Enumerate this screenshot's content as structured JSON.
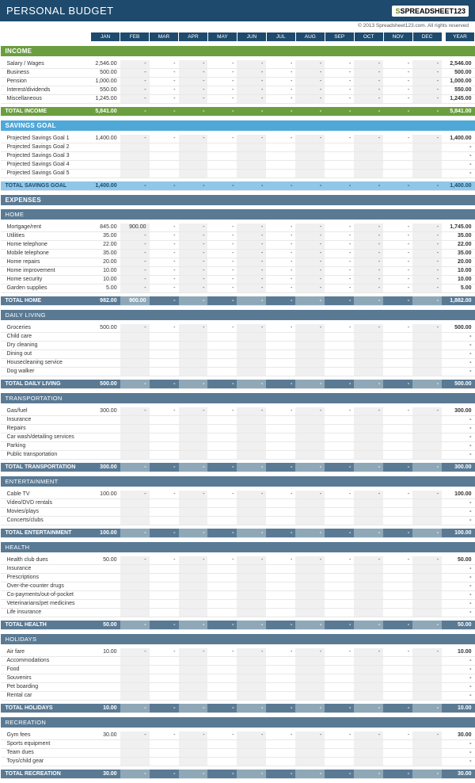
{
  "title": "PERSONAL BUDGET",
  "logo_text": "SPREADSHEET123",
  "copyright": "© 2013 Spreadsheet123.com. All rights reserved",
  "months": [
    "JAN",
    "FEB",
    "MAR",
    "APR",
    "MAY",
    "JUN",
    "JUL",
    "AUG",
    "SEP",
    "OCT",
    "NOV",
    "DEC",
    "YEAR"
  ],
  "sections": [
    {
      "type": "top",
      "title": "INCOME",
      "class": "income",
      "rows": [
        {
          "label": "Salary / Wages",
          "v": [
            "2,546.00",
            "-",
            "-",
            "-",
            "-",
            "-",
            "-",
            "-",
            "-",
            "-",
            "-",
            "-"
          ],
          "y": "2,546.00"
        },
        {
          "label": "Business",
          "v": [
            "500.00",
            "-",
            "-",
            "-",
            "-",
            "-",
            "-",
            "-",
            "-",
            "-",
            "-",
            "-"
          ],
          "y": "500.00"
        },
        {
          "label": "Pension",
          "v": [
            "1,000.00",
            "-",
            "-",
            "-",
            "-",
            "-",
            "-",
            "-",
            "-",
            "-",
            "-",
            "-"
          ],
          "y": "1,000.00"
        },
        {
          "label": "Interest/dividends",
          "v": [
            "550.00",
            "-",
            "-",
            "-",
            "-",
            "-",
            "-",
            "-",
            "-",
            "-",
            "-",
            "-"
          ],
          "y": "550.00"
        },
        {
          "label": "Miscellaneous",
          "v": [
            "1,245.00",
            "-",
            "-",
            "-",
            "-",
            "-",
            "-",
            "-",
            "-",
            "-",
            "-",
            "-"
          ],
          "y": "1,245.00"
        }
      ],
      "total": {
        "label": "TOTAL INCOME",
        "v": [
          "5,841.00",
          "-",
          "-",
          "-",
          "-",
          "-",
          "-",
          "-",
          "-",
          "-",
          "-",
          "-"
        ],
        "y": "5,841.00",
        "class": "total-income"
      }
    },
    {
      "type": "top",
      "title": "SAVINGS GOAL",
      "class": "savings",
      "rows": [
        {
          "label": "Projected Savings Goal 1",
          "v": [
            "1,400.00",
            "-",
            "-",
            "-",
            "-",
            "-",
            "-",
            "-",
            "-",
            "-",
            "-",
            "-"
          ],
          "y": "1,400.00"
        },
        {
          "label": "Projected Savings Goal 2",
          "v": [
            "",
            "",
            "",
            "",
            "",
            "",
            "",
            "",
            "",
            "",
            "",
            ""
          ],
          "y": "-"
        },
        {
          "label": "Projected Savings Goal 3",
          "v": [
            "",
            "",
            "",
            "",
            "",
            "",
            "",
            "",
            "",
            "",
            "",
            ""
          ],
          "y": "-"
        },
        {
          "label": "Projected Savings Goal 4",
          "v": [
            "",
            "",
            "",
            "",
            "",
            "",
            "",
            "",
            "",
            "",
            "",
            ""
          ],
          "y": "-"
        },
        {
          "label": "Projected Savings Goal 5",
          "v": [
            "",
            "",
            "",
            "",
            "",
            "",
            "",
            "",
            "",
            "",
            "",
            ""
          ],
          "y": "-"
        }
      ],
      "total": {
        "label": "TOTAL SAVINGS GOAL",
        "v": [
          "1,400.00",
          "-",
          "-",
          "-",
          "-",
          "-",
          "-",
          "-",
          "-",
          "-",
          "-",
          "-"
        ],
        "y": "1,400.00",
        "class": "total-savings"
      }
    }
  ],
  "expenses_title": "EXPENSES",
  "subsections": [
    {
      "title": "HOME",
      "rows": [
        {
          "label": "Mortgage/rent",
          "v": [
            "845.00",
            "900.00",
            "-",
            "-",
            "-",
            "-",
            "-",
            "-",
            "-",
            "-",
            "-",
            "-"
          ],
          "y": "1,745.00"
        },
        {
          "label": "Utilities",
          "v": [
            "35.00",
            "-",
            "-",
            "-",
            "-",
            "-",
            "-",
            "-",
            "-",
            "-",
            "-",
            "-"
          ],
          "y": "35.00"
        },
        {
          "label": "Home telephone",
          "v": [
            "22.00",
            "-",
            "-",
            "-",
            "-",
            "-",
            "-",
            "-",
            "-",
            "-",
            "-",
            "-"
          ],
          "y": "22.00"
        },
        {
          "label": "Mobile telephone",
          "v": [
            "35.00",
            "-",
            "-",
            "-",
            "-",
            "-",
            "-",
            "-",
            "-",
            "-",
            "-",
            "-"
          ],
          "y": "35.00"
        },
        {
          "label": "Home repairs",
          "v": [
            "20.00",
            "-",
            "-",
            "-",
            "-",
            "-",
            "-",
            "-",
            "-",
            "-",
            "-",
            "-"
          ],
          "y": "20.00"
        },
        {
          "label": "Home improvement",
          "v": [
            "10.00",
            "-",
            "-",
            "-",
            "-",
            "-",
            "-",
            "-",
            "-",
            "-",
            "-",
            "-"
          ],
          "y": "10.00"
        },
        {
          "label": "Home security",
          "v": [
            "10.00",
            "-",
            "-",
            "-",
            "-",
            "-",
            "-",
            "-",
            "-",
            "-",
            "-",
            "-"
          ],
          "y": "10.00"
        },
        {
          "label": "Garden supplies",
          "v": [
            "5.00",
            "-",
            "-",
            "-",
            "-",
            "-",
            "-",
            "-",
            "-",
            "-",
            "-",
            "-"
          ],
          "y": "5.00"
        }
      ],
      "total": {
        "label": "TOTAL HOME",
        "v": [
          "982.00",
          "900.00",
          "-",
          "-",
          "-",
          "-",
          "-",
          "-",
          "-",
          "-",
          "-",
          "-"
        ],
        "y": "1,882.00"
      }
    },
    {
      "title": "DAILY LIVING",
      "rows": [
        {
          "label": "Groceries",
          "v": [
            "500.00",
            "-",
            "-",
            "-",
            "-",
            "-",
            "-",
            "-",
            "-",
            "-",
            "-",
            "-"
          ],
          "y": "500.00"
        },
        {
          "label": "Child care",
          "v": [
            "",
            "",
            "",
            "",
            "",
            "",
            "",
            "",
            "",
            "",
            "",
            ""
          ],
          "y": "-"
        },
        {
          "label": "Dry cleaning",
          "v": [
            "",
            "",
            "",
            "",
            "",
            "",
            "",
            "",
            "",
            "",
            "",
            ""
          ],
          "y": "-"
        },
        {
          "label": "Dining out",
          "v": [
            "",
            "",
            "",
            "",
            "",
            "",
            "",
            "",
            "",
            "",
            "",
            ""
          ],
          "y": "-"
        },
        {
          "label": "Housecleaning service",
          "v": [
            "",
            "",
            "",
            "",
            "",
            "",
            "",
            "",
            "",
            "",
            "",
            ""
          ],
          "y": "-"
        },
        {
          "label": "Dog walker",
          "v": [
            "",
            "",
            "",
            "",
            "",
            "",
            "",
            "",
            "",
            "",
            "",
            ""
          ],
          "y": "-"
        }
      ],
      "total": {
        "label": "TOTAL DAILY LIVING",
        "v": [
          "500.00",
          "-",
          "-",
          "-",
          "-",
          "-",
          "-",
          "-",
          "-",
          "-",
          "-",
          "-"
        ],
        "y": "500.00"
      }
    },
    {
      "title": "TRANSPORTATION",
      "rows": [
        {
          "label": "Gas/fuel",
          "v": [
            "300.00",
            "-",
            "-",
            "-",
            "-",
            "-",
            "-",
            "-",
            "-",
            "-",
            "-",
            "-"
          ],
          "y": "300.00"
        },
        {
          "label": "Insurance",
          "v": [
            "",
            "",
            "",
            "",
            "",
            "",
            "",
            "",
            "",
            "",
            "",
            ""
          ],
          "y": "-"
        },
        {
          "label": "Repairs",
          "v": [
            "",
            "",
            "",
            "",
            "",
            "",
            "",
            "",
            "",
            "",
            "",
            ""
          ],
          "y": "-"
        },
        {
          "label": "Car wash/detailing services",
          "v": [
            "",
            "",
            "",
            "",
            "",
            "",
            "",
            "",
            "",
            "",
            "",
            ""
          ],
          "y": "-"
        },
        {
          "label": "Parking",
          "v": [
            "",
            "",
            "",
            "",
            "",
            "",
            "",
            "",
            "",
            "",
            "",
            ""
          ],
          "y": "-"
        },
        {
          "label": "Public transportation",
          "v": [
            "",
            "",
            "",
            "",
            "",
            "",
            "",
            "",
            "",
            "",
            "",
            ""
          ],
          "y": "-"
        }
      ],
      "total": {
        "label": "TOTAL TRANSPORTATION",
        "v": [
          "300.00",
          "-",
          "-",
          "-",
          "-",
          "-",
          "-",
          "-",
          "-",
          "-",
          "-",
          "-"
        ],
        "y": "300.00"
      }
    },
    {
      "title": "ENTERTAINMENT",
      "rows": [
        {
          "label": "Cable TV",
          "v": [
            "100.00",
            "-",
            "-",
            "-",
            "-",
            "-",
            "-",
            "-",
            "-",
            "-",
            "-",
            "-"
          ],
          "y": "100.00"
        },
        {
          "label": "Video/DVD rentals",
          "v": [
            "",
            "",
            "",
            "",
            "",
            "",
            "",
            "",
            "",
            "",
            "",
            ""
          ],
          "y": "-"
        },
        {
          "label": "Movies/plays",
          "v": [
            "",
            "",
            "",
            "",
            "",
            "",
            "",
            "",
            "",
            "",
            "",
            ""
          ],
          "y": "-"
        },
        {
          "label": "Concerts/clubs",
          "v": [
            "",
            "",
            "",
            "",
            "",
            "",
            "",
            "",
            "",
            "",
            "",
            ""
          ],
          "y": "-"
        }
      ],
      "total": {
        "label": "TOTAL ENTERTAINMENT",
        "v": [
          "100.00",
          "-",
          "-",
          "-",
          "-",
          "-",
          "-",
          "-",
          "-",
          "-",
          "-",
          "-"
        ],
        "y": "100.00"
      }
    },
    {
      "title": "HEALTH",
      "rows": [
        {
          "label": "Health club dues",
          "v": [
            "50.00",
            "-",
            "-",
            "-",
            "-",
            "-",
            "-",
            "-",
            "-",
            "-",
            "-",
            "-"
          ],
          "y": "50.00"
        },
        {
          "label": "Insurance",
          "v": [
            "",
            "",
            "",
            "",
            "",
            "",
            "",
            "",
            "",
            "",
            "",
            ""
          ],
          "y": "-"
        },
        {
          "label": "Prescriptions",
          "v": [
            "",
            "",
            "",
            "",
            "",
            "",
            "",
            "",
            "",
            "",
            "",
            ""
          ],
          "y": "-"
        },
        {
          "label": "Over-the-counter drugs",
          "v": [
            "",
            "",
            "",
            "",
            "",
            "",
            "",
            "",
            "",
            "",
            "",
            ""
          ],
          "y": "-"
        },
        {
          "label": "Co-payments/out-of-pocket",
          "v": [
            "",
            "",
            "",
            "",
            "",
            "",
            "",
            "",
            "",
            "",
            "",
            ""
          ],
          "y": "-"
        },
        {
          "label": "Veterinarians/pet medicines",
          "v": [
            "",
            "",
            "",
            "",
            "",
            "",
            "",
            "",
            "",
            "",
            "",
            ""
          ],
          "y": "-"
        },
        {
          "label": "Life insurance",
          "v": [
            "",
            "",
            "",
            "",
            "",
            "",
            "",
            "",
            "",
            "",
            "",
            ""
          ],
          "y": "-"
        }
      ],
      "total": {
        "label": "TOTAL HEALTH",
        "v": [
          "50.00",
          "-",
          "-",
          "-",
          "-",
          "-",
          "-",
          "-",
          "-",
          "-",
          "-",
          "-"
        ],
        "y": "50.00"
      }
    },
    {
      "title": "HOLIDAYS",
      "rows": [
        {
          "label": "Air fare",
          "v": [
            "10.00",
            "-",
            "-",
            "-",
            "-",
            "-",
            "-",
            "-",
            "-",
            "-",
            "-",
            "-"
          ],
          "y": "10.00"
        },
        {
          "label": "Accommodations",
          "v": [
            "",
            "",
            "",
            "",
            "",
            "",
            "",
            "",
            "",
            "",
            "",
            ""
          ],
          "y": "-"
        },
        {
          "label": "Food",
          "v": [
            "",
            "",
            "",
            "",
            "",
            "",
            "",
            "",
            "",
            "",
            "",
            ""
          ],
          "y": "-"
        },
        {
          "label": "Souvenirs",
          "v": [
            "",
            "",
            "",
            "",
            "",
            "",
            "",
            "",
            "",
            "",
            "",
            ""
          ],
          "y": "-"
        },
        {
          "label": "Pet boarding",
          "v": [
            "",
            "",
            "",
            "",
            "",
            "",
            "",
            "",
            "",
            "",
            "",
            ""
          ],
          "y": "-"
        },
        {
          "label": "Rental car",
          "v": [
            "",
            "",
            "",
            "",
            "",
            "",
            "",
            "",
            "",
            "",
            "",
            ""
          ],
          "y": "-"
        }
      ],
      "total": {
        "label": "TOTAL HOLIDAYS",
        "v": [
          "10.00",
          "-",
          "-",
          "-",
          "-",
          "-",
          "-",
          "-",
          "-",
          "-",
          "-",
          "-"
        ],
        "y": "10.00"
      }
    },
    {
      "title": "RECREATION",
      "rows": [
        {
          "label": "Gym fees",
          "v": [
            "30.00",
            "-",
            "-",
            "-",
            "-",
            "-",
            "-",
            "-",
            "-",
            "-",
            "-",
            "-"
          ],
          "y": "30.00"
        },
        {
          "label": "Sports equipment",
          "v": [
            "",
            "",
            "",
            "",
            "",
            "",
            "",
            "",
            "",
            "",
            "",
            ""
          ],
          "y": "-"
        },
        {
          "label": "Team dues",
          "v": [
            "",
            "",
            "",
            "",
            "",
            "",
            "",
            "",
            "",
            "",
            "",
            ""
          ],
          "y": "-"
        },
        {
          "label": "Toys/child gear",
          "v": [
            "",
            "",
            "",
            "",
            "",
            "",
            "",
            "",
            "",
            "",
            "",
            ""
          ],
          "y": "-"
        }
      ],
      "total": {
        "label": "TOTAL RECREATION",
        "v": [
          "30.00",
          "-",
          "-",
          "-",
          "-",
          "-",
          "-",
          "-",
          "-",
          "-",
          "-",
          "-"
        ],
        "y": "30.00"
      }
    }
  ]
}
